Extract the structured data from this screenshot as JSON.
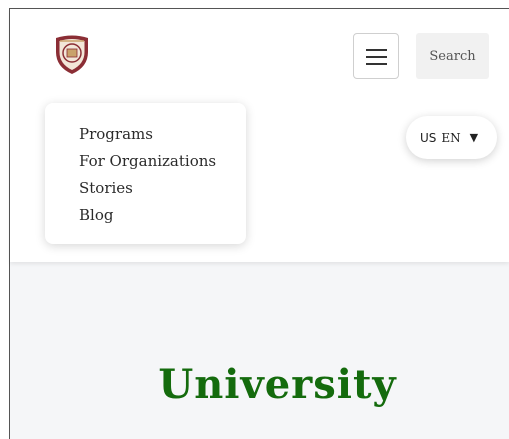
{
  "header": {
    "logo_icon": "university-crest-icon",
    "menu_icon": "hamburger-menu-icon",
    "search_label": "Search"
  },
  "nav_menu": {
    "items": [
      {
        "label": "Programs"
      },
      {
        "label": "For Organizations"
      },
      {
        "label": "Stories"
      },
      {
        "label": "Blog"
      }
    ]
  },
  "language": {
    "flag": "US",
    "code": "EN",
    "caret_icon": "caret-down-icon"
  },
  "hero": {
    "title": "University"
  },
  "colors": {
    "brand_green": "#146b0d",
    "crest_maroon": "#8b2e35",
    "hero_background": "#f5f6f8"
  }
}
